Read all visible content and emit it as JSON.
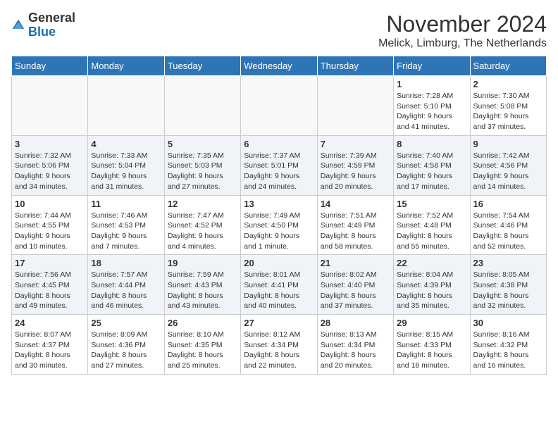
{
  "logo": {
    "line1": "General",
    "line2": "Blue"
  },
  "title": "November 2024",
  "subtitle": "Melick, Limburg, The Netherlands",
  "weekdays": [
    "Sunday",
    "Monday",
    "Tuesday",
    "Wednesday",
    "Thursday",
    "Friday",
    "Saturday"
  ],
  "weeks": [
    [
      {
        "day": "",
        "info": ""
      },
      {
        "day": "",
        "info": ""
      },
      {
        "day": "",
        "info": ""
      },
      {
        "day": "",
        "info": ""
      },
      {
        "day": "",
        "info": ""
      },
      {
        "day": "1",
        "info": "Sunrise: 7:28 AM\nSunset: 5:10 PM\nDaylight: 9 hours\nand 41 minutes."
      },
      {
        "day": "2",
        "info": "Sunrise: 7:30 AM\nSunset: 5:08 PM\nDaylight: 9 hours\nand 37 minutes."
      }
    ],
    [
      {
        "day": "3",
        "info": "Sunrise: 7:32 AM\nSunset: 5:06 PM\nDaylight: 9 hours\nand 34 minutes."
      },
      {
        "day": "4",
        "info": "Sunrise: 7:33 AM\nSunset: 5:04 PM\nDaylight: 9 hours\nand 31 minutes."
      },
      {
        "day": "5",
        "info": "Sunrise: 7:35 AM\nSunset: 5:03 PM\nDaylight: 9 hours\nand 27 minutes."
      },
      {
        "day": "6",
        "info": "Sunrise: 7:37 AM\nSunset: 5:01 PM\nDaylight: 9 hours\nand 24 minutes."
      },
      {
        "day": "7",
        "info": "Sunrise: 7:39 AM\nSunset: 4:59 PM\nDaylight: 9 hours\nand 20 minutes."
      },
      {
        "day": "8",
        "info": "Sunrise: 7:40 AM\nSunset: 4:58 PM\nDaylight: 9 hours\nand 17 minutes."
      },
      {
        "day": "9",
        "info": "Sunrise: 7:42 AM\nSunset: 4:56 PM\nDaylight: 9 hours\nand 14 minutes."
      }
    ],
    [
      {
        "day": "10",
        "info": "Sunrise: 7:44 AM\nSunset: 4:55 PM\nDaylight: 9 hours\nand 10 minutes."
      },
      {
        "day": "11",
        "info": "Sunrise: 7:46 AM\nSunset: 4:53 PM\nDaylight: 9 hours\nand 7 minutes."
      },
      {
        "day": "12",
        "info": "Sunrise: 7:47 AM\nSunset: 4:52 PM\nDaylight: 9 hours\nand 4 minutes."
      },
      {
        "day": "13",
        "info": "Sunrise: 7:49 AM\nSunset: 4:50 PM\nDaylight: 9 hours\nand 1 minute."
      },
      {
        "day": "14",
        "info": "Sunrise: 7:51 AM\nSunset: 4:49 PM\nDaylight: 8 hours\nand 58 minutes."
      },
      {
        "day": "15",
        "info": "Sunrise: 7:52 AM\nSunset: 4:48 PM\nDaylight: 8 hours\nand 55 minutes."
      },
      {
        "day": "16",
        "info": "Sunrise: 7:54 AM\nSunset: 4:46 PM\nDaylight: 8 hours\nand 52 minutes."
      }
    ],
    [
      {
        "day": "17",
        "info": "Sunrise: 7:56 AM\nSunset: 4:45 PM\nDaylight: 8 hours\nand 49 minutes."
      },
      {
        "day": "18",
        "info": "Sunrise: 7:57 AM\nSunset: 4:44 PM\nDaylight: 8 hours\nand 46 minutes."
      },
      {
        "day": "19",
        "info": "Sunrise: 7:59 AM\nSunset: 4:43 PM\nDaylight: 8 hours\nand 43 minutes."
      },
      {
        "day": "20",
        "info": "Sunrise: 8:01 AM\nSunset: 4:41 PM\nDaylight: 8 hours\nand 40 minutes."
      },
      {
        "day": "21",
        "info": "Sunrise: 8:02 AM\nSunset: 4:40 PM\nDaylight: 8 hours\nand 37 minutes."
      },
      {
        "day": "22",
        "info": "Sunrise: 8:04 AM\nSunset: 4:39 PM\nDaylight: 8 hours\nand 35 minutes."
      },
      {
        "day": "23",
        "info": "Sunrise: 8:05 AM\nSunset: 4:38 PM\nDaylight: 8 hours\nand 32 minutes."
      }
    ],
    [
      {
        "day": "24",
        "info": "Sunrise: 8:07 AM\nSunset: 4:37 PM\nDaylight: 8 hours\nand 30 minutes."
      },
      {
        "day": "25",
        "info": "Sunrise: 8:09 AM\nSunset: 4:36 PM\nDaylight: 8 hours\nand 27 minutes."
      },
      {
        "day": "26",
        "info": "Sunrise: 8:10 AM\nSunset: 4:35 PM\nDaylight: 8 hours\nand 25 minutes."
      },
      {
        "day": "27",
        "info": "Sunrise: 8:12 AM\nSunset: 4:34 PM\nDaylight: 8 hours\nand 22 minutes."
      },
      {
        "day": "28",
        "info": "Sunrise: 8:13 AM\nSunset: 4:34 PM\nDaylight: 8 hours\nand 20 minutes."
      },
      {
        "day": "29",
        "info": "Sunrise: 8:15 AM\nSunset: 4:33 PM\nDaylight: 8 hours\nand 18 minutes."
      },
      {
        "day": "30",
        "info": "Sunrise: 8:16 AM\nSunset: 4:32 PM\nDaylight: 8 hours\nand 16 minutes."
      }
    ]
  ]
}
